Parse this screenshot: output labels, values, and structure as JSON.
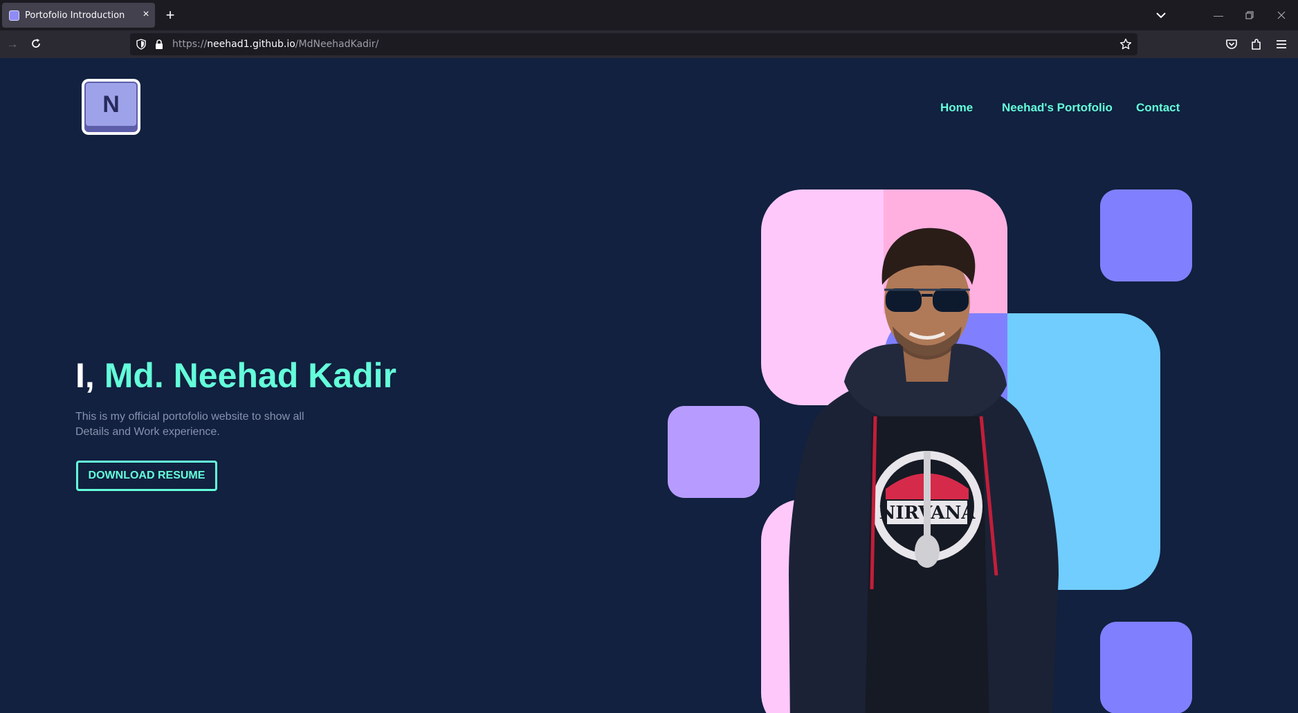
{
  "browser": {
    "tab_title": "Portofolio Introduction",
    "url_prefix": "https://",
    "url_host": "neehad1.github.io",
    "url_path": "/MdNeehadKadir/"
  },
  "site": {
    "logo_letter": "N",
    "nav": [
      "Home",
      "Neehad's Portofolio",
      "Contact"
    ],
    "hero": {
      "title_lead": "I, ",
      "title_name": "Md. Neehad Kadir",
      "description": "This is my official portofolio website to show all Details and Work experience.",
      "button_label": "DOWNLOAD RESUME"
    }
  },
  "colors": {
    "page_bg": "#11213f",
    "accent": "#64ffda",
    "pink": "#ffc8fb",
    "pink_dark": "#ffb0e0",
    "blue": "#70cdfe",
    "violet": "#8080ff",
    "lavender": "#b79bff"
  }
}
